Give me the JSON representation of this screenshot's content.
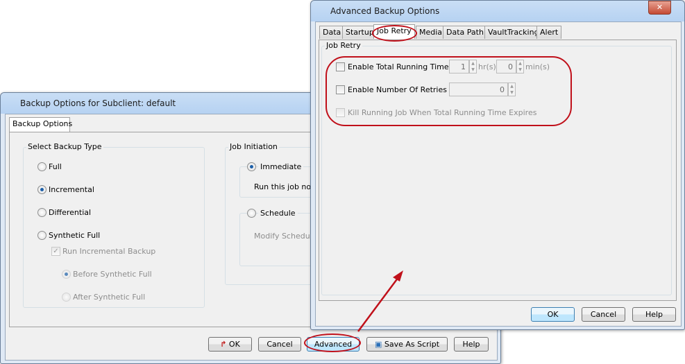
{
  "back_window": {
    "title": "Backup Options for Subclient: default",
    "tab": "Backup Options",
    "backup_type": {
      "label": "Select Backup Type",
      "options": [
        {
          "label": "Full",
          "selected": false,
          "enabled": true
        },
        {
          "label": "Incremental",
          "selected": true,
          "enabled": true
        },
        {
          "label": "Differential",
          "selected": false,
          "enabled": true
        },
        {
          "label": "Synthetic Full",
          "selected": false,
          "enabled": true
        }
      ],
      "run_incremental": {
        "label": "Run Incremental Backup",
        "checked": true,
        "enabled": false
      },
      "sub_options": [
        {
          "label": "Before Synthetic Full",
          "selected": true
        },
        {
          "label": "After Synthetic Full",
          "selected": false
        }
      ]
    },
    "job_initiation": {
      "label": "Job Initiation",
      "immediate": "Immediate",
      "immediate_desc": "Run this job now",
      "schedule": "Schedule",
      "schedule_desc": "Modify Schedule"
    },
    "buttons": {
      "ok": "OK",
      "cancel": "Cancel",
      "advanced": "Advanced",
      "save_script": "Save As Script",
      "help": "Help"
    }
  },
  "front_window": {
    "title": "Advanced Backup Options",
    "tabs": [
      "Data",
      "Startup",
      "Job Retry",
      "Media",
      "Data Path",
      "VaultTracking",
      "Alert"
    ],
    "active_tab": "Job Retry",
    "group_label": "Job Retry",
    "total_running_time": {
      "label": "Enable Total Running Time",
      "checked": false,
      "hours": "1",
      "hours_unit": "hr(s)",
      "minutes": "0",
      "minutes_unit": "min(s)"
    },
    "retries": {
      "label": "Enable Number Of Retries",
      "checked": false,
      "value": "0"
    },
    "kill_job": {
      "label": "Kill Running Job When Total Running Time Expires",
      "checked": false,
      "enabled": false
    },
    "buttons": {
      "ok": "OK",
      "cancel": "Cancel",
      "help": "Help"
    }
  },
  "annotation_color": "#c0101a"
}
